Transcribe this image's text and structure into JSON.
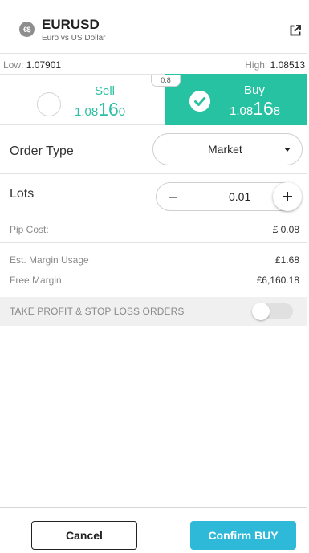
{
  "symbol": {
    "badge": "€$",
    "name": "EURUSD",
    "description": "Euro vs US Dollar"
  },
  "range": {
    "low_label": "Low:",
    "low_value": "1.07901",
    "high_label": "High:",
    "high_value": "1.08513"
  },
  "trade": {
    "spread": "0.8",
    "sell": {
      "label": "Sell",
      "price_prefix": "1.08",
      "price_big": "16",
      "price_suffix": "0",
      "selected": false
    },
    "buy": {
      "label": "Buy",
      "price_prefix": "1.08",
      "price_big": "16",
      "price_suffix": "8",
      "selected": true
    }
  },
  "order_type": {
    "label": "Order Type",
    "value": "Market"
  },
  "lots": {
    "label": "Lots",
    "value": "0.01"
  },
  "pip_cost": {
    "label": "Pip Cost:",
    "value": "£ 0.08"
  },
  "margin": {
    "usage_label": "Est. Margin Usage",
    "usage_value": "£1.68",
    "free_label": "Free Margin",
    "free_value": "£6,160.18"
  },
  "take_profit": {
    "label": "TAKE PROFIT & STOP LOSS ORDERS",
    "enabled": false
  },
  "footer": {
    "cancel_label": "Cancel",
    "confirm_label": "Confirm BUY"
  },
  "colors": {
    "buy_green": "#26c2a2",
    "sell_text": "#2bbfa4",
    "confirm_blue": "#2fb9d9"
  }
}
